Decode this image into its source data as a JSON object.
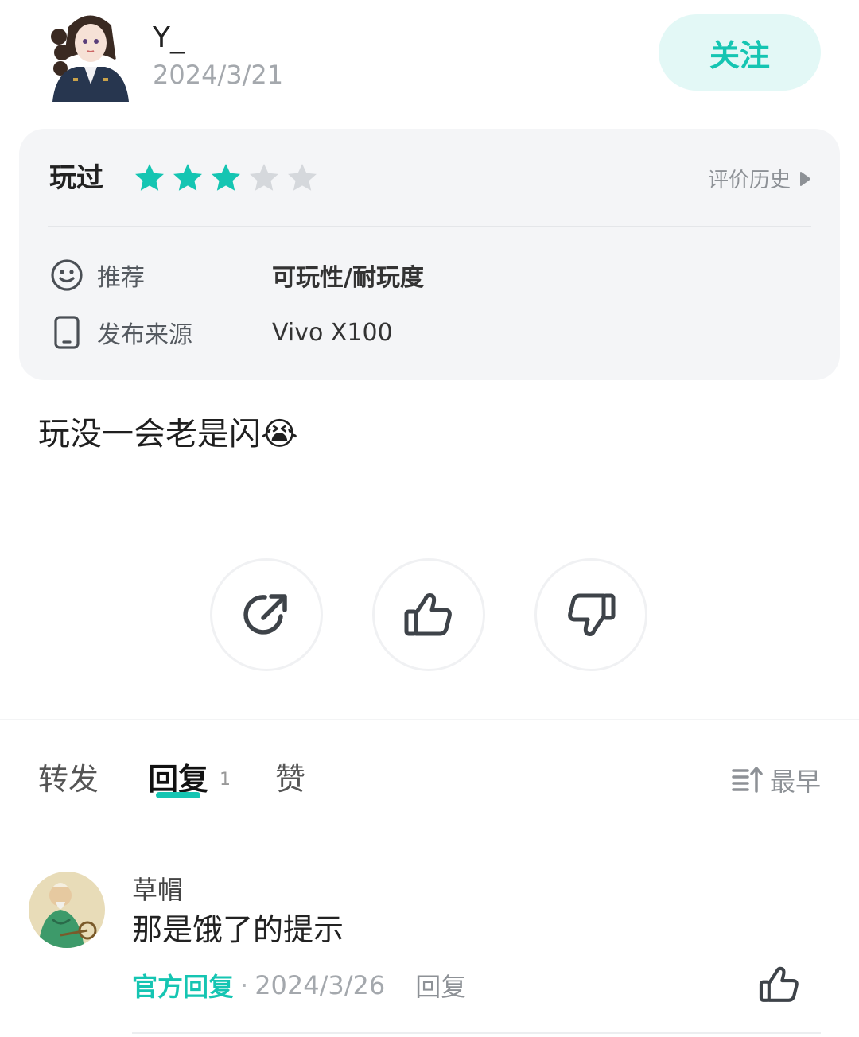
{
  "header": {
    "username": "Y_",
    "date": "2024/3/21",
    "follow_label": "关注"
  },
  "card": {
    "played_label": "玩过",
    "rating": 3,
    "rating_max": 5,
    "history_label": "评价历史",
    "recommend_key": "推荐",
    "recommend_value": "可玩性/耐玩度",
    "source_key": "发布来源",
    "source_value": "Vivo X100"
  },
  "review": {
    "text": "玩没一会老是闪😭"
  },
  "tabs": {
    "forward": "转发",
    "reply": "回复",
    "reply_count": "1",
    "like": "赞",
    "sort_label": "最早"
  },
  "comment": {
    "name": "草帽",
    "text": "那是饿了的提示",
    "official_label": "官方回复",
    "dot": "·",
    "date": "2024/3/26",
    "reply_label": "回复"
  },
  "colors": {
    "accent": "#15c5b2",
    "star_off": "#d5d8dc",
    "card_bg": "#f4f5f7",
    "follow_bg": "#e3f8f6"
  }
}
